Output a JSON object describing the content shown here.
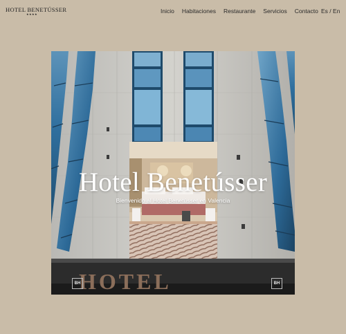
{
  "header": {
    "logo_text": "HOTEL BENETÚSSER",
    "logo_stars": "★★★★",
    "nav": [
      {
        "label": "Inicio"
      },
      {
        "label": "Habitaciones"
      },
      {
        "label": "Restaurante"
      },
      {
        "label": "Servicios"
      },
      {
        "label": "Contacto"
      }
    ],
    "lang": {
      "es": "Es",
      "separator": "/",
      "en": "En"
    }
  },
  "hero": {
    "title": "Hotel Benetússer",
    "subtitle": "Bienvenido al Hotel Benetússer en Valencia",
    "sign_text": "HOTEL",
    "sign_badge": "BH"
  },
  "colors": {
    "page_background": "#c9bca8",
    "text": "#222222",
    "hero_text": "#ffffff",
    "glass_blue": "#2f6f9e"
  }
}
